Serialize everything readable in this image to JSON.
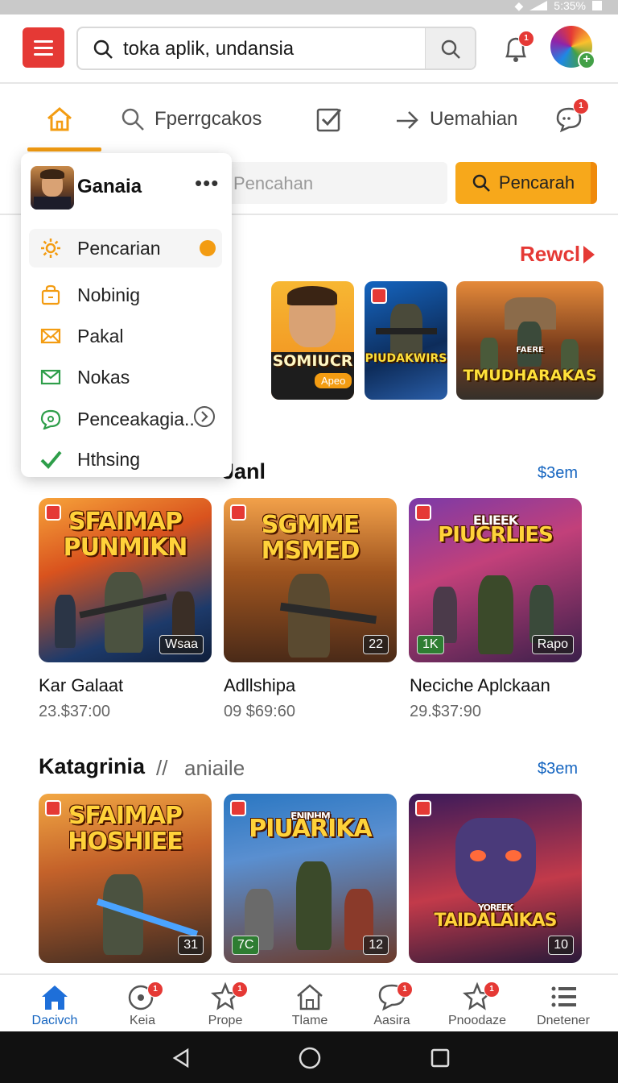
{
  "status_bar": {
    "battery_text": "5:35%"
  },
  "header": {
    "search_value": "toka aplik, undansia",
    "notification_badge": "1"
  },
  "tabs": [
    {
      "label": ""
    },
    {
      "label": "Fperrgcakos"
    },
    {
      "label": ""
    },
    {
      "label": "Uemahian"
    },
    {
      "label": "",
      "badge": "1"
    }
  ],
  "secondary_search": {
    "placeholder": "Pencahan",
    "button_label": "Pencarah"
  },
  "dropdown": {
    "user_name": "Ganaia",
    "more": "•••",
    "items": [
      {
        "label": "Pencarian",
        "icon": "gear-icon"
      },
      {
        "label": "Nobinig",
        "icon": "bag-icon"
      },
      {
        "label": "Pakal",
        "icon": "mail-icon"
      },
      {
        "label": "Nokas",
        "icon": "envelope-icon"
      },
      {
        "label": "Penceakagia..",
        "icon": "chat-icon"
      },
      {
        "label": "Hthsing",
        "icon": "check-icon"
      }
    ]
  },
  "featured": {
    "link_label": "Rewcl",
    "cards": [
      {
        "title": "SOMIUCR",
        "tag": "Apeo"
      },
      {
        "title": "PIUDAKWIRS"
      },
      {
        "title": "TMUDHARAKAS",
        "subtitle": "FAERE"
      }
    ]
  },
  "section1": {
    "title": "Janl",
    "see_all": "$3em",
    "items": [
      {
        "card_title": "SFAIMAP PUNMIKN",
        "tag": "Wsaa",
        "name": "Kar Galaat",
        "price": "23.$37:00"
      },
      {
        "card_title": "SGMME MSMED",
        "tag": "22",
        "name": "Adllshipa",
        "price": "09 $69:60"
      },
      {
        "card_title": "PIUCRLIES",
        "card_kicker": "ELIEEK",
        "tag_left": "1K",
        "tag": "Rapo",
        "name": "Neciche Aplckaan",
        "price": "29.$37:90"
      }
    ]
  },
  "section2": {
    "title": "Katagrinia",
    "subtitle": "aniaile",
    "see_all": "$3em",
    "items": [
      {
        "card_title": "SFAIMAP HOSHIEE",
        "tag": "31"
      },
      {
        "card_title": "PIUARIKA",
        "card_kicker": "ENINHM",
        "tag_left": "7C",
        "tag": "12"
      },
      {
        "card_title": "TAIDALAIKAS",
        "card_kicker": "YOREEK",
        "tag": "10"
      }
    ]
  },
  "bottom_nav": [
    {
      "label": "Dacivch",
      "active": true
    },
    {
      "label": "Keia",
      "badge": "1"
    },
    {
      "label": "Prope",
      "badge": "1"
    },
    {
      "label": "Tlame"
    },
    {
      "label": "Aasira",
      "badge": "1"
    },
    {
      "label": "Pnoodaze",
      "badge": "1"
    },
    {
      "label": "Dnetener"
    }
  ],
  "colors": {
    "accent_orange": "#f39c12",
    "brand_red": "#e53935",
    "link_blue": "#1565c0"
  }
}
